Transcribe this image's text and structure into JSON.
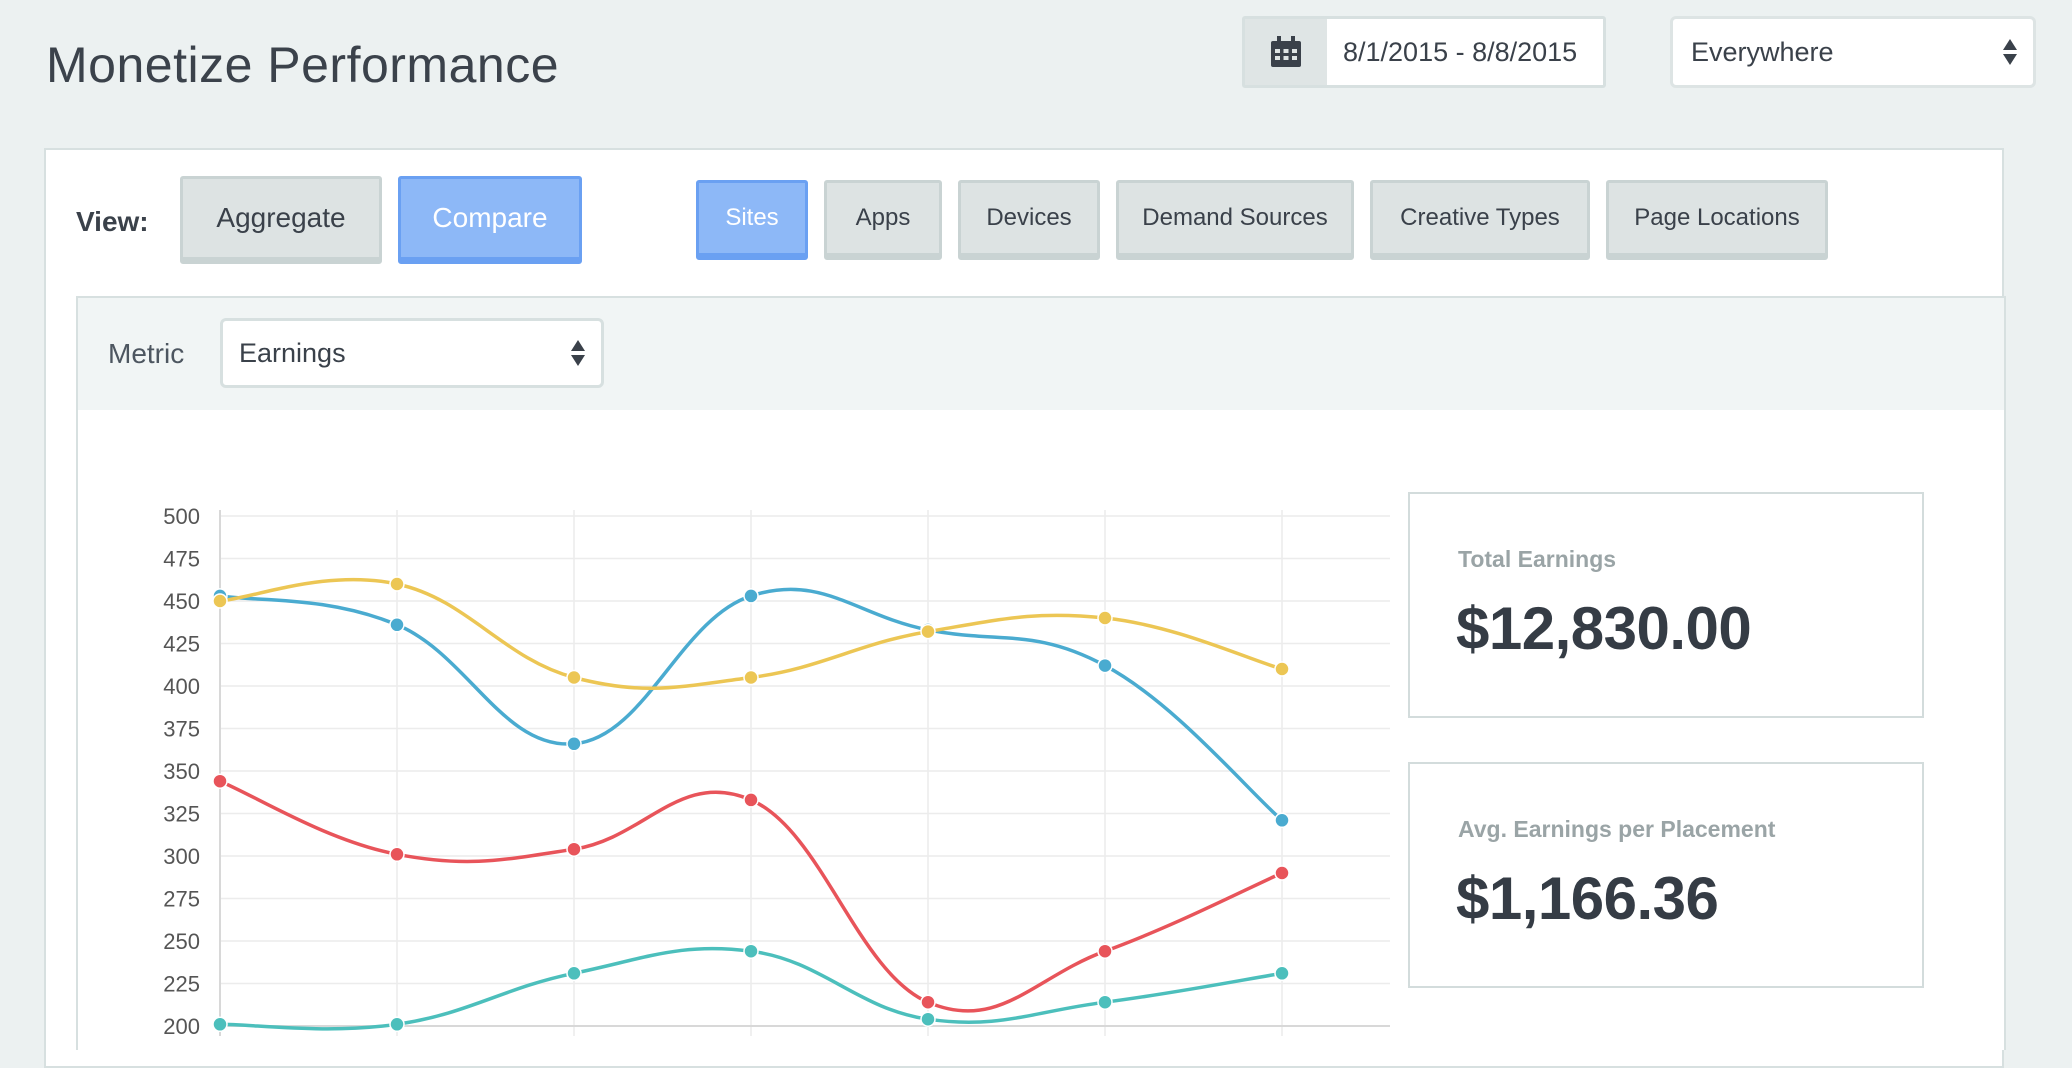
{
  "header": {
    "title": "Monetize Performance",
    "date_range": "8/1/2015 - 8/8/2015",
    "location": "Everywhere"
  },
  "view": {
    "label": "View:",
    "modes": [
      "Aggregate",
      "Compare"
    ],
    "active_mode": "Compare",
    "dimensions": [
      "Sites",
      "Apps",
      "Devices",
      "Demand Sources",
      "Creative Types",
      "Page Locations"
    ],
    "active_dimension": "Sites"
  },
  "metric": {
    "label": "Metric",
    "selected": "Earnings"
  },
  "stats": [
    {
      "label": "Total Earnings",
      "value": "$12,830.00"
    },
    {
      "label": "Avg. Earnings per Placement",
      "value": "$1,166.36"
    }
  ],
  "colors": {
    "accent": "#8db8f7",
    "series_blue": "#4aabd0",
    "series_yellow": "#ecc654",
    "series_red": "#e8545a",
    "series_teal": "#4cbfbc"
  },
  "chart_data": {
    "type": "line",
    "x": [
      1,
      2,
      3,
      4,
      5,
      6,
      7
    ],
    "ylim": [
      200,
      500
    ],
    "yticks": [
      200,
      225,
      250,
      275,
      300,
      325,
      350,
      375,
      400,
      425,
      450,
      475,
      500
    ],
    "grid": true,
    "smooth": true,
    "series": [
      {
        "color": "#4aabd0",
        "values": [
          453,
          436,
          366,
          453,
          433,
          412,
          321
        ]
      },
      {
        "color": "#ecc654",
        "values": [
          450,
          460,
          405,
          405,
          432,
          440,
          410
        ]
      },
      {
        "color": "#e8545a",
        "values": [
          344,
          301,
          304,
          333,
          214,
          244,
          290
        ]
      },
      {
        "color": "#4cbfbc",
        "values": [
          201,
          201,
          231,
          244,
          204,
          214,
          231
        ]
      }
    ]
  }
}
